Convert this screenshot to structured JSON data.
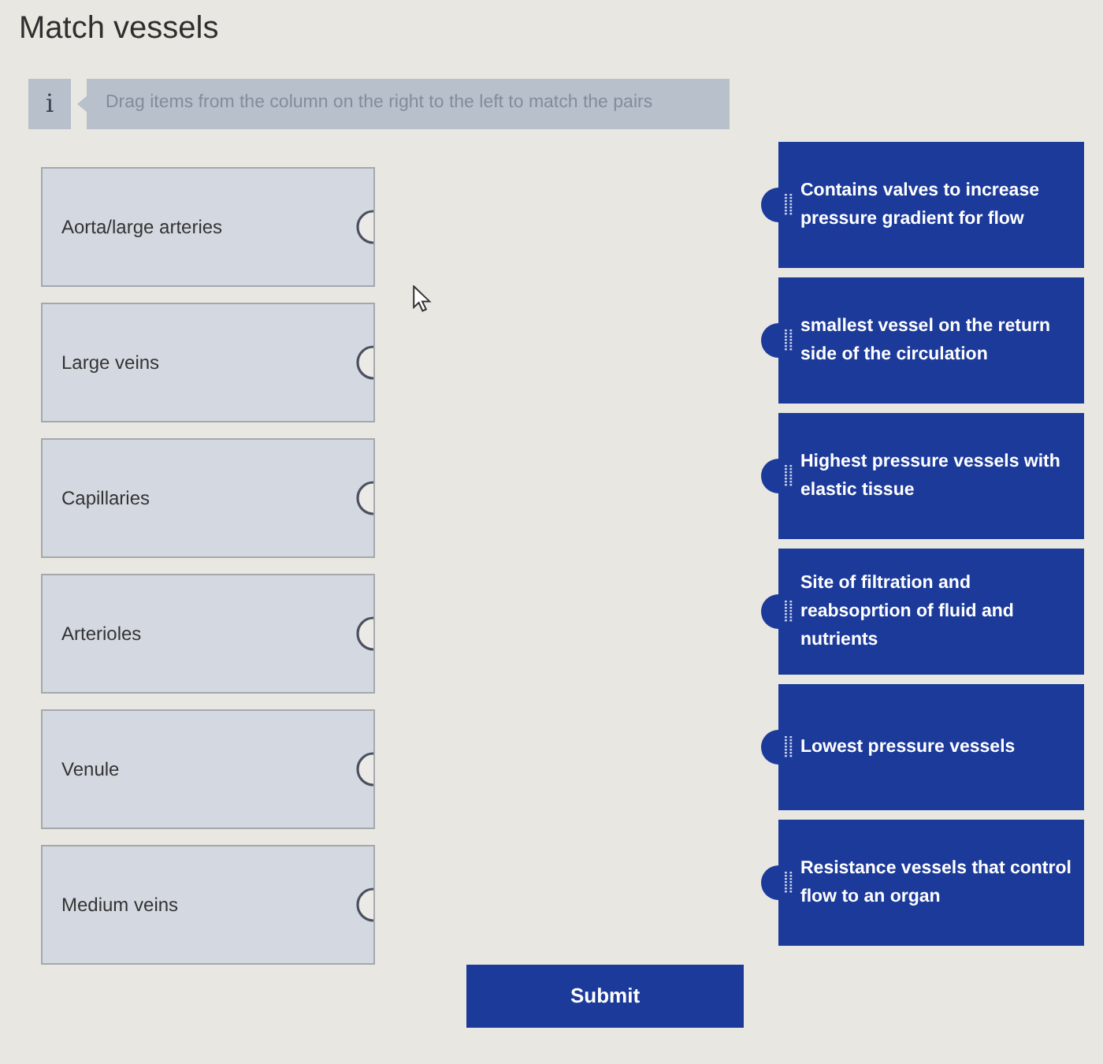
{
  "title": "Match vessels",
  "instruction": {
    "icon_text": "i",
    "text": "Drag items from the column on the right to the left to match the pairs"
  },
  "premises": [
    "Aorta/large arteries",
    "Large veins",
    "Capillaries",
    "Arterioles",
    "Venule",
    "Medium veins"
  ],
  "responses": [
    "Contains valves to increase pressure gradient for flow",
    "smallest vessel on the return side of the circulation",
    "Highest pressure vessels with elastic tissue",
    "Site of filtration and reabsoprtion of fluid and nutrients",
    "Lowest pressure vessels",
    "Resistance vessels that control flow to an organ"
  ],
  "submit": "Submit"
}
